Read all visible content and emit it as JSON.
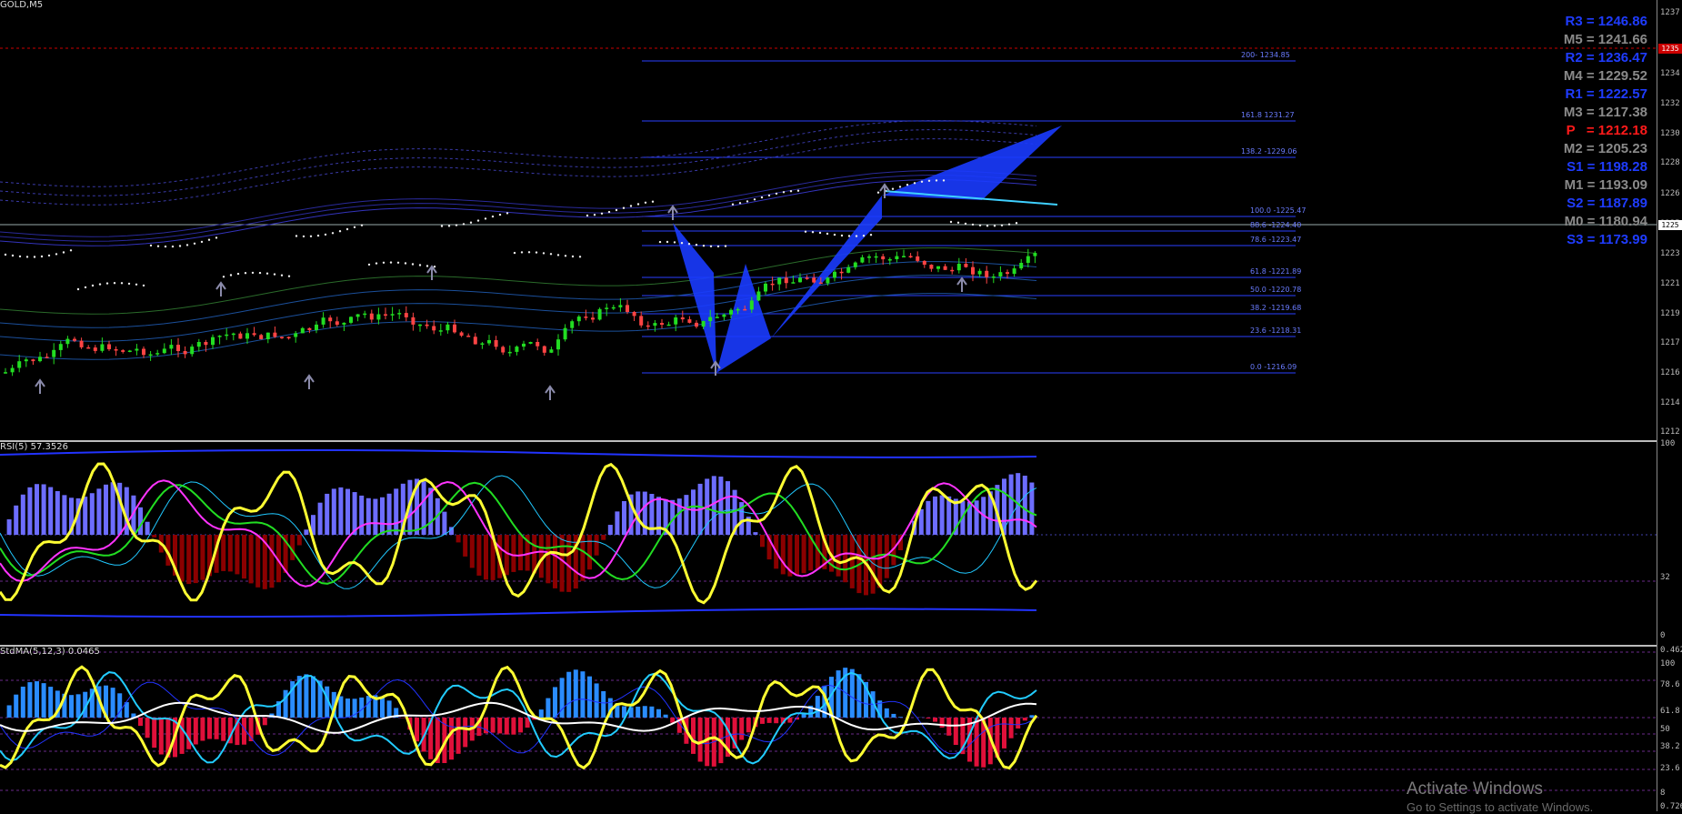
{
  "main": {
    "title": "GOLD,M5",
    "pivots": [
      {
        "label": "R3 = 1246.86",
        "color": "#1f3cff"
      },
      {
        "label": "M5 = 1241.66",
        "color": "#8a8a8a"
      },
      {
        "label": "R2 = 1236.47",
        "color": "#1f3cff"
      },
      {
        "label": "M4 = 1229.52",
        "color": "#8a8a8a"
      },
      {
        "label": "R1 = 1222.57",
        "color": "#1f3cff"
      },
      {
        "label": "M3 = 1217.38",
        "color": "#8a8a8a"
      },
      {
        "label": "P   = 1212.18",
        "color": "#ff1a1a"
      },
      {
        "label": "M2 = 1205.23",
        "color": "#8a8a8a"
      },
      {
        "label": "S1 = 1198.28",
        "color": "#1f3cff"
      },
      {
        "label": "M1 = 1193.09",
        "color": "#8a8a8a"
      },
      {
        "label": "S2 = 1187.89",
        "color": "#1f3cff"
      },
      {
        "label": "M0 = 1180.94",
        "color": "#8a8a8a"
      },
      {
        "label": "S3 = 1173.99",
        "color": "#1f3cff"
      }
    ],
    "fib_levels": [
      {
        "label": "200- 1234.85"
      },
      {
        "label": "161.8 1231.27"
      },
      {
        "label": "138.2 -1229.06"
      },
      {
        "label": "100.0 -1225.47"
      },
      {
        "label": "88.6 -1224.40"
      },
      {
        "label": "78.6 -1223.47"
      },
      {
        "label": "61.8 -1221.89"
      },
      {
        "label": "50.0 -1220.78"
      },
      {
        "label": "38.2 -1219.68"
      },
      {
        "label": "23.6 -1218.31"
      },
      {
        "label": "0.0 -1216.09"
      }
    ],
    "axis_labels": [
      "1237",
      "1234",
      "1232",
      "1230",
      "1228",
      "1226",
      "1225",
      "1223",
      "1221",
      "1219",
      "1217",
      "1216",
      "1214",
      "1212"
    ],
    "current_price_tag": "1225",
    "red_line_tag": "1235"
  },
  "rsi": {
    "title": "RSI(5) 57.3526",
    "axis_labels": [
      "100",
      "32",
      "0"
    ]
  },
  "stoch": {
    "title": "StdMA(5,12,3) 0.0465",
    "axis_labels": [
      "0.462",
      "100",
      "78.6",
      "61.8",
      "50",
      "38.2",
      "23.6",
      "8",
      "0.726"
    ]
  },
  "watermark": {
    "title": "Activate Windows",
    "subtitle": "Go to Settings to activate Windows."
  },
  "colors": {
    "bull": "#22dd22",
    "bear": "#ff4444",
    "fib": "#2a3fff",
    "pattern": "#1a3bff",
    "rsi_pos": "#6d6dff",
    "rsi_neg": "#8b0000",
    "stoch_pos": "#2a8cff",
    "stoch_neg": "#e0103a"
  }
}
